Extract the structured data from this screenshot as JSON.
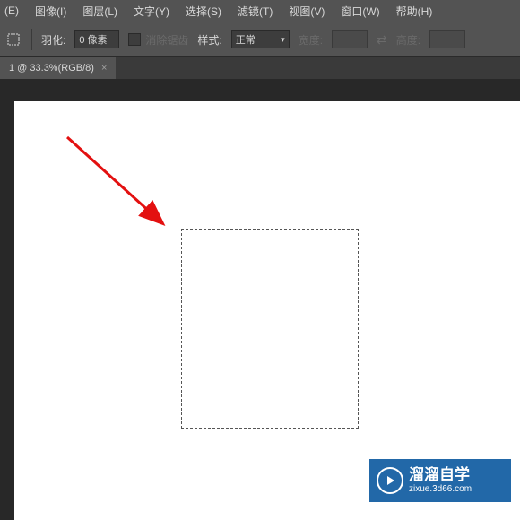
{
  "menu": {
    "edit": "(E)",
    "image": "图像(I)",
    "layer": "图层(L)",
    "type": "文字(Y)",
    "select": "选择(S)",
    "filter": "滤镜(T)",
    "view": "视图(V)",
    "window": "窗口(W)",
    "help": "帮助(H)"
  },
  "options": {
    "feather_label": "羽化:",
    "feather_value": "0 像素",
    "antialias_label": "消除锯齿",
    "style_label": "样式:",
    "style_value": "正常",
    "width_label": "宽度:",
    "height_label": "高度:"
  },
  "tab": {
    "label": "1 @ 33.3%(RGB/8)",
    "close": "×"
  },
  "watermark": {
    "main": "溜溜自学",
    "sub": "zixue.3d66.com"
  }
}
